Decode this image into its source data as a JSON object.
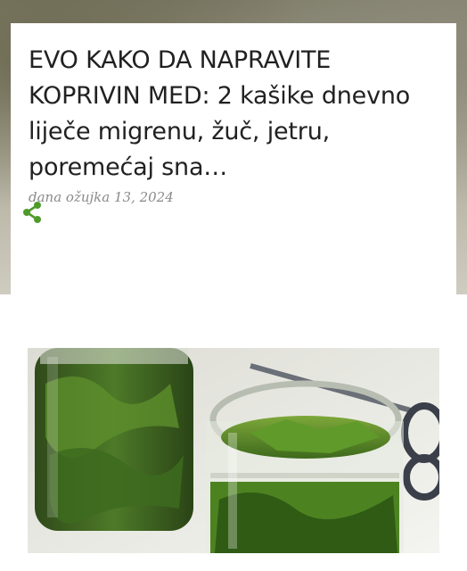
{
  "post": {
    "title": "EVO KAKO DA NAPRAVITE KOPRIVIN MED: 2 kašike dnevno liječe migrenu, žuč, jetru, poremećaj sna…",
    "date": "dana ožujka 13, 2024"
  },
  "share": {
    "icon": "share-icon"
  },
  "image": {
    "icon": "photo-jars-nettle-leaves"
  },
  "colors": {
    "accent": "#4e9b2b",
    "title": "#212121",
    "date": "#8a8a8a"
  }
}
